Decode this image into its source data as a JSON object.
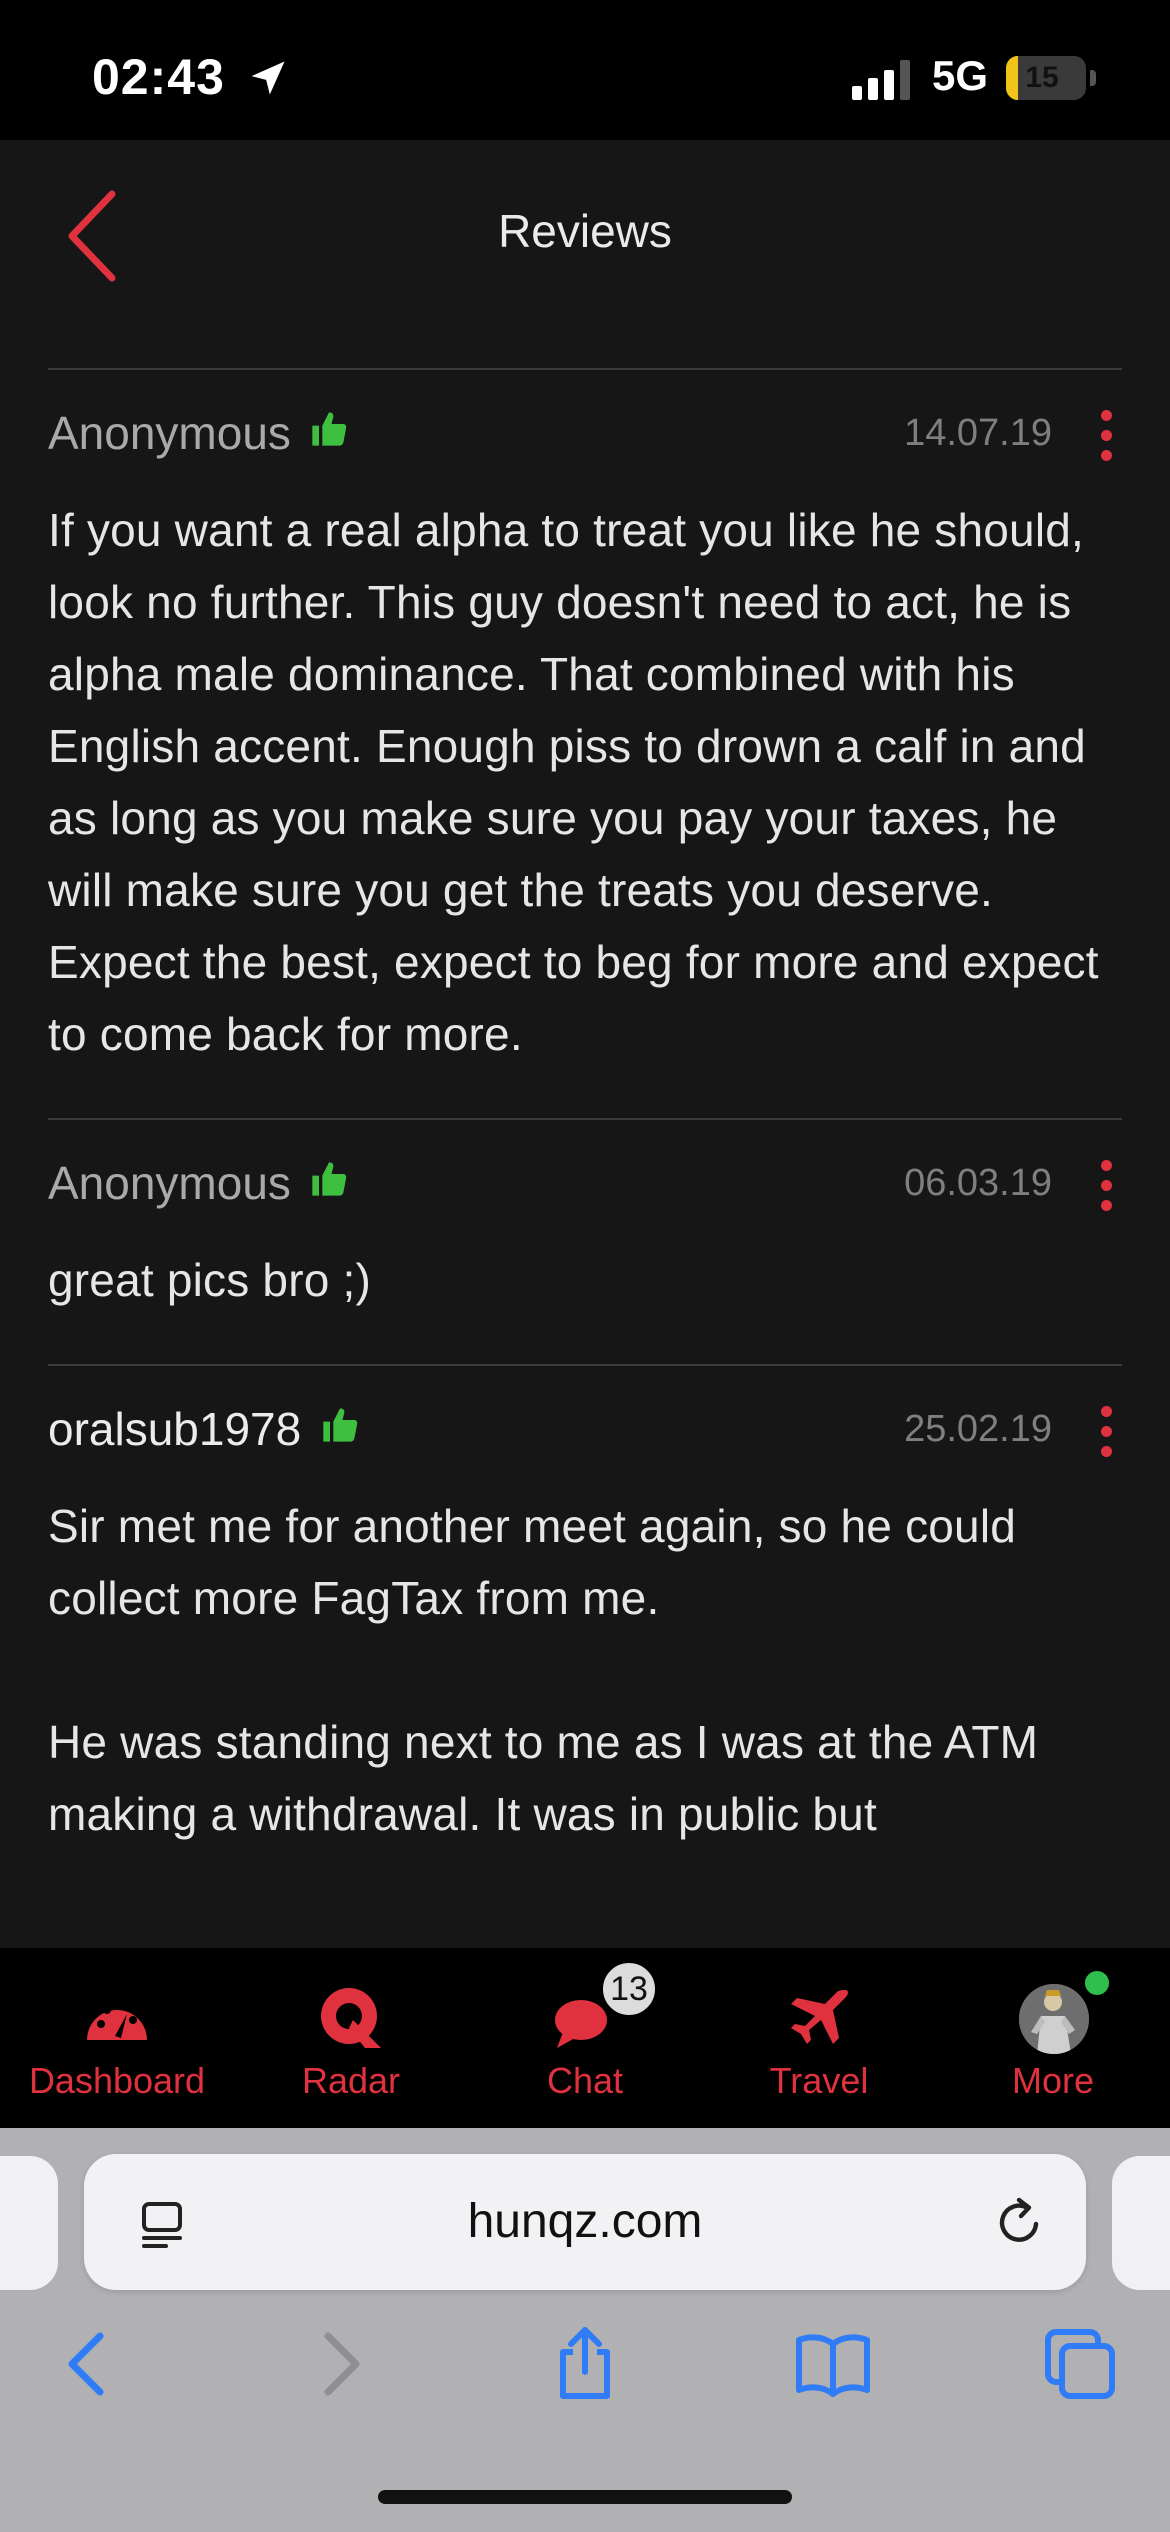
{
  "status_bar": {
    "time": "02:43",
    "network": "5G",
    "battery": "15",
    "battery_level": 0.15
  },
  "header": {
    "title": "Reviews"
  },
  "reviews": [
    {
      "author": "Anonymous",
      "date": "14.07.19",
      "text": "If you want a real alpha to treat you like he should, look no further. This guy doesn't need to act, he is alpha male dominance. That combined with his English accent. Enough piss to drown a calf in and as long as you make sure you pay your taxes, he will make sure you get the treats you deserve. Expect the best, expect to beg for more and expect to come back for more."
    },
    {
      "author": "Anonymous",
      "date": "06.03.19",
      "text": "great pics bro ;)"
    },
    {
      "author": "oralsub1978",
      "date": "25.02.19",
      "text": "Sir met me for another meet again, so he could collect more FagTax from me.\n\nHe was standing next to me as I was at the ATM making a withdrawal. It was in public but"
    }
  ],
  "tab_bar": {
    "tabs": [
      {
        "label": "Dashboard",
        "icon": "dashboard-gauge-icon"
      },
      {
        "label": "Radar",
        "icon": "radar-icon"
      },
      {
        "label": "Chat",
        "icon": "chat-bubbles-icon",
        "badge": "13"
      },
      {
        "label": "Travel",
        "icon": "airplane-icon"
      },
      {
        "label": "More",
        "icon": "avatar"
      }
    ]
  },
  "browser": {
    "url": "hunqz.com"
  },
  "colors": {
    "accent": "#e0313f",
    "like": "#3fbf3f",
    "background": "#161617",
    "browser_blue": "#2f7cf6"
  }
}
